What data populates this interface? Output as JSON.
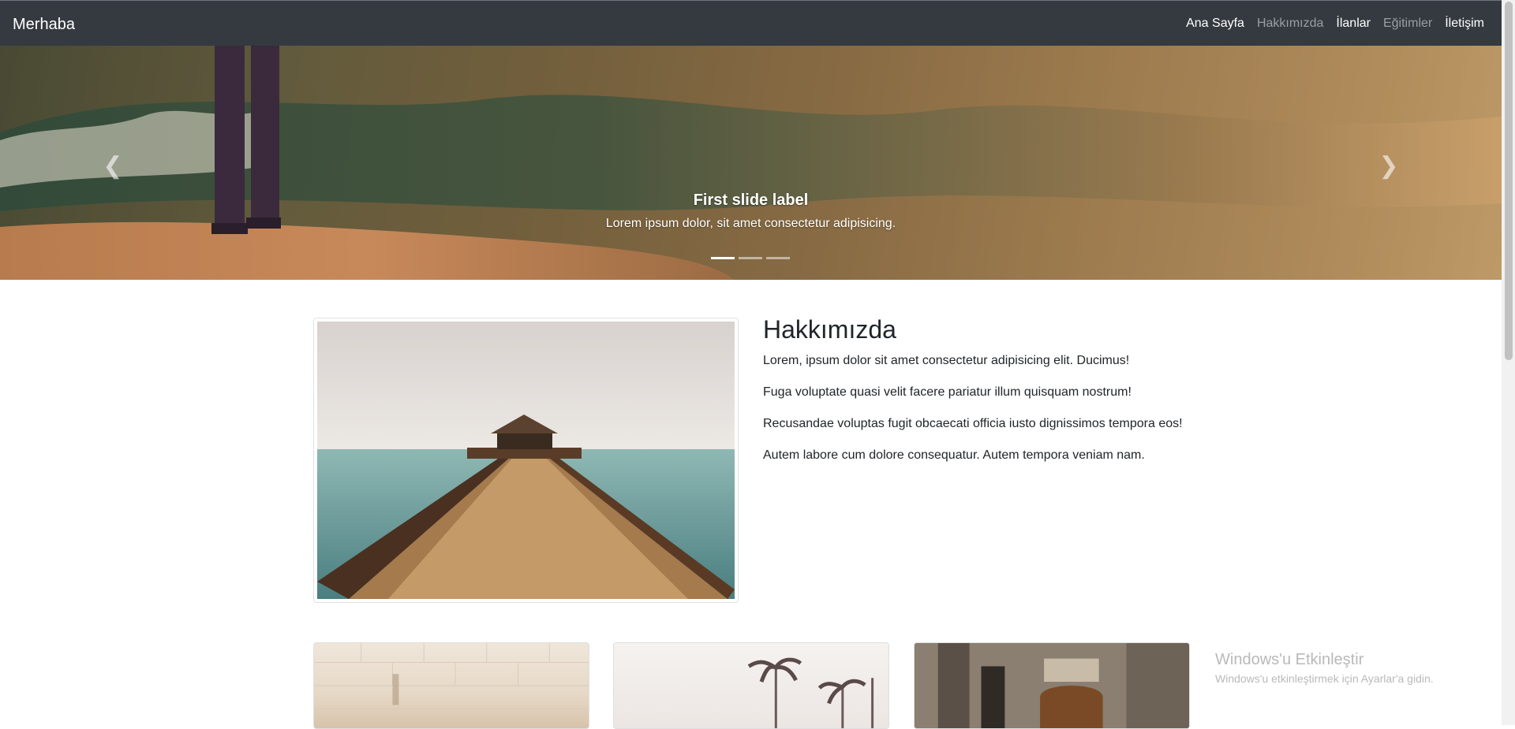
{
  "navbar": {
    "brand": "Merhaba",
    "items": [
      {
        "label": "Ana Sayfa",
        "active": true
      },
      {
        "label": "Hakkımızda",
        "active": false
      },
      {
        "label": "İlanlar",
        "active": true
      },
      {
        "label": "Eğitimler",
        "active": false
      },
      {
        "label": "İletişim",
        "active": true
      }
    ]
  },
  "carousel": {
    "caption_title": "First slide label",
    "caption_text": "Lorem ipsum dolor, sit amet consectetur adipisicing.",
    "prev_icon": "chevron-left-icon",
    "next_icon": "chevron-right-icon",
    "indicator_count": 3,
    "active_index": 0
  },
  "about": {
    "title": "Hakkımızda",
    "paragraphs": [
      "Lorem, ipsum dolor sit amet consectetur adipisicing elit. Ducimus!",
      "Fuga voluptate quasi velit facere pariatur illum quisquam nostrum!",
      "Recusandae voluptas fugit obcaecati officia iusto dignissimos tempora eos!",
      "Autem labore cum dolore consequatur. Autem tempora veniam nam."
    ]
  },
  "watermark": {
    "title": "Windows'u Etkinleştir",
    "subtitle": "Windows'u etkinleştirmek için Ayarlar'a gidin."
  },
  "colors": {
    "navbar_bg": "#343a40",
    "nav_muted": "rgba(255,255,255,0.5)"
  }
}
